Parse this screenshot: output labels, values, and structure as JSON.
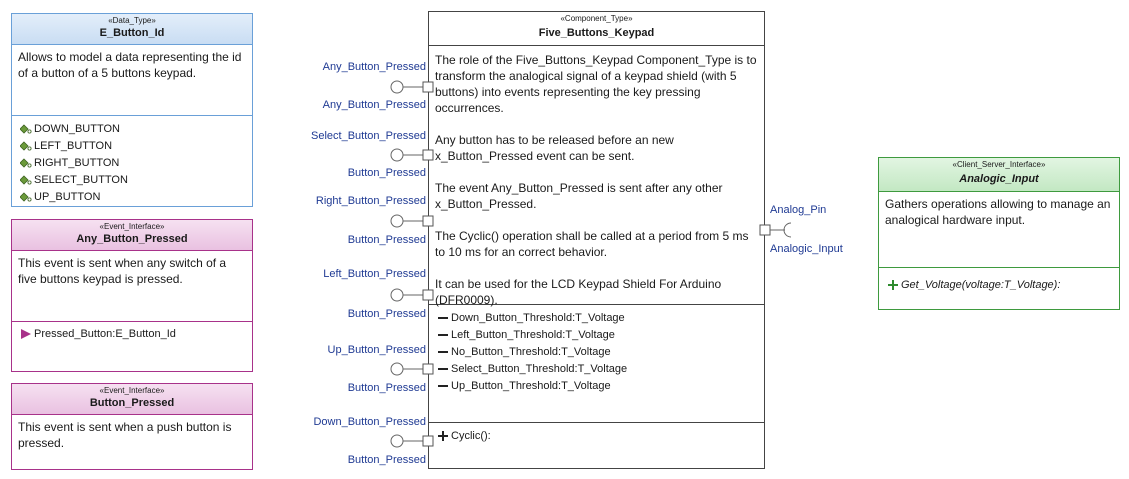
{
  "data_type": {
    "stereotype": "«Data_Type»",
    "name": "E_Button_Id",
    "description": "Allows to model a data representing the id of a button of a 5 buttons keypad.",
    "literals": [
      "DOWN_BUTTON",
      "LEFT_BUTTON",
      "RIGHT_BUTTON",
      "SELECT_BUTTON",
      "UP_BUTTON"
    ]
  },
  "event_any": {
    "stereotype": "«Event_Interface»",
    "name": "Any_Button_Pressed",
    "description": "This event is sent when any switch of a five buttons keypad is pressed.",
    "parameter": "Pressed_Button:E_Button_Id"
  },
  "event_button": {
    "stereotype": "«Event_Interface»",
    "name": "Button_Pressed",
    "description": "This event is sent when a push button is pressed."
  },
  "component": {
    "stereotype": "«Component_Type»",
    "name": "Five_Buttons_Keypad",
    "paragraphs": [
      "The role of the Five_Buttons_Keypad Component_Type is to transform the analogical signal of a keypad shield (with 5 buttons) into events representing the key pressing occurrences.",
      "Any button has to be released before an new x_Button_Pressed event can be sent.",
      "The event Any_Button_Pressed is sent after any other x_Button_Pressed.",
      "The Cyclic() operation shall be called at a period from 5 ms to 10 ms for an correct behavior.",
      "It can be used for the LCD Keypad Shield For Arduino (DFR0009)."
    ],
    "attributes": [
      "Down_Button_Threshold:T_Voltage",
      "Left_Button_Threshold:T_Voltage",
      "No_Button_Threshold:T_Voltage",
      "Select_Button_Threshold:T_Voltage",
      "Up_Button_Threshold:T_Voltage"
    ],
    "operation": "Cyclic():"
  },
  "ports_left": [
    {
      "name": "Any_Button_Pressed",
      "type": "Any_Button_Pressed"
    },
    {
      "name": "Select_Button_Pressed",
      "type": "Button_Pressed"
    },
    {
      "name": "Right_Button_Pressed",
      "type": "Button_Pressed"
    },
    {
      "name": "Left_Button_Pressed",
      "type": "Button_Pressed"
    },
    {
      "name": "Up_Button_Pressed",
      "type": "Button_Pressed"
    },
    {
      "name": "Down_Button_Pressed",
      "type": "Button_Pressed"
    }
  ],
  "port_right": {
    "name": "Analog_Pin",
    "type": "Analogic_Input"
  },
  "client_server": {
    "stereotype": "«Client_Server_Interface»",
    "name": "Analogic_Input",
    "description": "Gathers operations allowing to manage an analogical hardware input.",
    "operation": "Get_Voltage(voltage:T_Voltage):"
  },
  "colors": {
    "data_type": "#3b7fc4",
    "event_interface": "#a8328a",
    "client_server": "#3e9a3e",
    "port_label": "#1f3a93"
  }
}
